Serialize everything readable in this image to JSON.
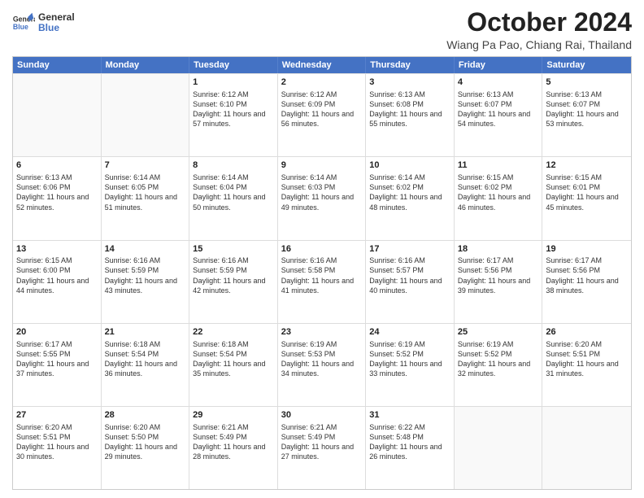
{
  "header": {
    "logo_line1": "General",
    "logo_line2": "Blue",
    "main_title": "October 2024",
    "sub_title": "Wiang Pa Pao, Chiang Rai, Thailand"
  },
  "days_of_week": [
    "Sunday",
    "Monday",
    "Tuesday",
    "Wednesday",
    "Thursday",
    "Friday",
    "Saturday"
  ],
  "weeks": [
    [
      {
        "day": "",
        "sunrise": "",
        "sunset": "",
        "daylight": ""
      },
      {
        "day": "",
        "sunrise": "",
        "sunset": "",
        "daylight": ""
      },
      {
        "day": "1",
        "sunrise": "Sunrise: 6:12 AM",
        "sunset": "Sunset: 6:10 PM",
        "daylight": "Daylight: 11 hours and 57 minutes."
      },
      {
        "day": "2",
        "sunrise": "Sunrise: 6:12 AM",
        "sunset": "Sunset: 6:09 PM",
        "daylight": "Daylight: 11 hours and 56 minutes."
      },
      {
        "day": "3",
        "sunrise": "Sunrise: 6:13 AM",
        "sunset": "Sunset: 6:08 PM",
        "daylight": "Daylight: 11 hours and 55 minutes."
      },
      {
        "day": "4",
        "sunrise": "Sunrise: 6:13 AM",
        "sunset": "Sunset: 6:07 PM",
        "daylight": "Daylight: 11 hours and 54 minutes."
      },
      {
        "day": "5",
        "sunrise": "Sunrise: 6:13 AM",
        "sunset": "Sunset: 6:07 PM",
        "daylight": "Daylight: 11 hours and 53 minutes."
      }
    ],
    [
      {
        "day": "6",
        "sunrise": "Sunrise: 6:13 AM",
        "sunset": "Sunset: 6:06 PM",
        "daylight": "Daylight: 11 hours and 52 minutes."
      },
      {
        "day": "7",
        "sunrise": "Sunrise: 6:14 AM",
        "sunset": "Sunset: 6:05 PM",
        "daylight": "Daylight: 11 hours and 51 minutes."
      },
      {
        "day": "8",
        "sunrise": "Sunrise: 6:14 AM",
        "sunset": "Sunset: 6:04 PM",
        "daylight": "Daylight: 11 hours and 50 minutes."
      },
      {
        "day": "9",
        "sunrise": "Sunrise: 6:14 AM",
        "sunset": "Sunset: 6:03 PM",
        "daylight": "Daylight: 11 hours and 49 minutes."
      },
      {
        "day": "10",
        "sunrise": "Sunrise: 6:14 AM",
        "sunset": "Sunset: 6:02 PM",
        "daylight": "Daylight: 11 hours and 48 minutes."
      },
      {
        "day": "11",
        "sunrise": "Sunrise: 6:15 AM",
        "sunset": "Sunset: 6:02 PM",
        "daylight": "Daylight: 11 hours and 46 minutes."
      },
      {
        "day": "12",
        "sunrise": "Sunrise: 6:15 AM",
        "sunset": "Sunset: 6:01 PM",
        "daylight": "Daylight: 11 hours and 45 minutes."
      }
    ],
    [
      {
        "day": "13",
        "sunrise": "Sunrise: 6:15 AM",
        "sunset": "Sunset: 6:00 PM",
        "daylight": "Daylight: 11 hours and 44 minutes."
      },
      {
        "day": "14",
        "sunrise": "Sunrise: 6:16 AM",
        "sunset": "Sunset: 5:59 PM",
        "daylight": "Daylight: 11 hours and 43 minutes."
      },
      {
        "day": "15",
        "sunrise": "Sunrise: 6:16 AM",
        "sunset": "Sunset: 5:59 PM",
        "daylight": "Daylight: 11 hours and 42 minutes."
      },
      {
        "day": "16",
        "sunrise": "Sunrise: 6:16 AM",
        "sunset": "Sunset: 5:58 PM",
        "daylight": "Daylight: 11 hours and 41 minutes."
      },
      {
        "day": "17",
        "sunrise": "Sunrise: 6:16 AM",
        "sunset": "Sunset: 5:57 PM",
        "daylight": "Daylight: 11 hours and 40 minutes."
      },
      {
        "day": "18",
        "sunrise": "Sunrise: 6:17 AM",
        "sunset": "Sunset: 5:56 PM",
        "daylight": "Daylight: 11 hours and 39 minutes."
      },
      {
        "day": "19",
        "sunrise": "Sunrise: 6:17 AM",
        "sunset": "Sunset: 5:56 PM",
        "daylight": "Daylight: 11 hours and 38 minutes."
      }
    ],
    [
      {
        "day": "20",
        "sunrise": "Sunrise: 6:17 AM",
        "sunset": "Sunset: 5:55 PM",
        "daylight": "Daylight: 11 hours and 37 minutes."
      },
      {
        "day": "21",
        "sunrise": "Sunrise: 6:18 AM",
        "sunset": "Sunset: 5:54 PM",
        "daylight": "Daylight: 11 hours and 36 minutes."
      },
      {
        "day": "22",
        "sunrise": "Sunrise: 6:18 AM",
        "sunset": "Sunset: 5:54 PM",
        "daylight": "Daylight: 11 hours and 35 minutes."
      },
      {
        "day": "23",
        "sunrise": "Sunrise: 6:19 AM",
        "sunset": "Sunset: 5:53 PM",
        "daylight": "Daylight: 11 hours and 34 minutes."
      },
      {
        "day": "24",
        "sunrise": "Sunrise: 6:19 AM",
        "sunset": "Sunset: 5:52 PM",
        "daylight": "Daylight: 11 hours and 33 minutes."
      },
      {
        "day": "25",
        "sunrise": "Sunrise: 6:19 AM",
        "sunset": "Sunset: 5:52 PM",
        "daylight": "Daylight: 11 hours and 32 minutes."
      },
      {
        "day": "26",
        "sunrise": "Sunrise: 6:20 AM",
        "sunset": "Sunset: 5:51 PM",
        "daylight": "Daylight: 11 hours and 31 minutes."
      }
    ],
    [
      {
        "day": "27",
        "sunrise": "Sunrise: 6:20 AM",
        "sunset": "Sunset: 5:51 PM",
        "daylight": "Daylight: 11 hours and 30 minutes."
      },
      {
        "day": "28",
        "sunrise": "Sunrise: 6:20 AM",
        "sunset": "Sunset: 5:50 PM",
        "daylight": "Daylight: 11 hours and 29 minutes."
      },
      {
        "day": "29",
        "sunrise": "Sunrise: 6:21 AM",
        "sunset": "Sunset: 5:49 PM",
        "daylight": "Daylight: 11 hours and 28 minutes."
      },
      {
        "day": "30",
        "sunrise": "Sunrise: 6:21 AM",
        "sunset": "Sunset: 5:49 PM",
        "daylight": "Daylight: 11 hours and 27 minutes."
      },
      {
        "day": "31",
        "sunrise": "Sunrise: 6:22 AM",
        "sunset": "Sunset: 5:48 PM",
        "daylight": "Daylight: 11 hours and 26 minutes."
      },
      {
        "day": "",
        "sunrise": "",
        "sunset": "",
        "daylight": ""
      },
      {
        "day": "",
        "sunrise": "",
        "sunset": "",
        "daylight": ""
      }
    ]
  ]
}
